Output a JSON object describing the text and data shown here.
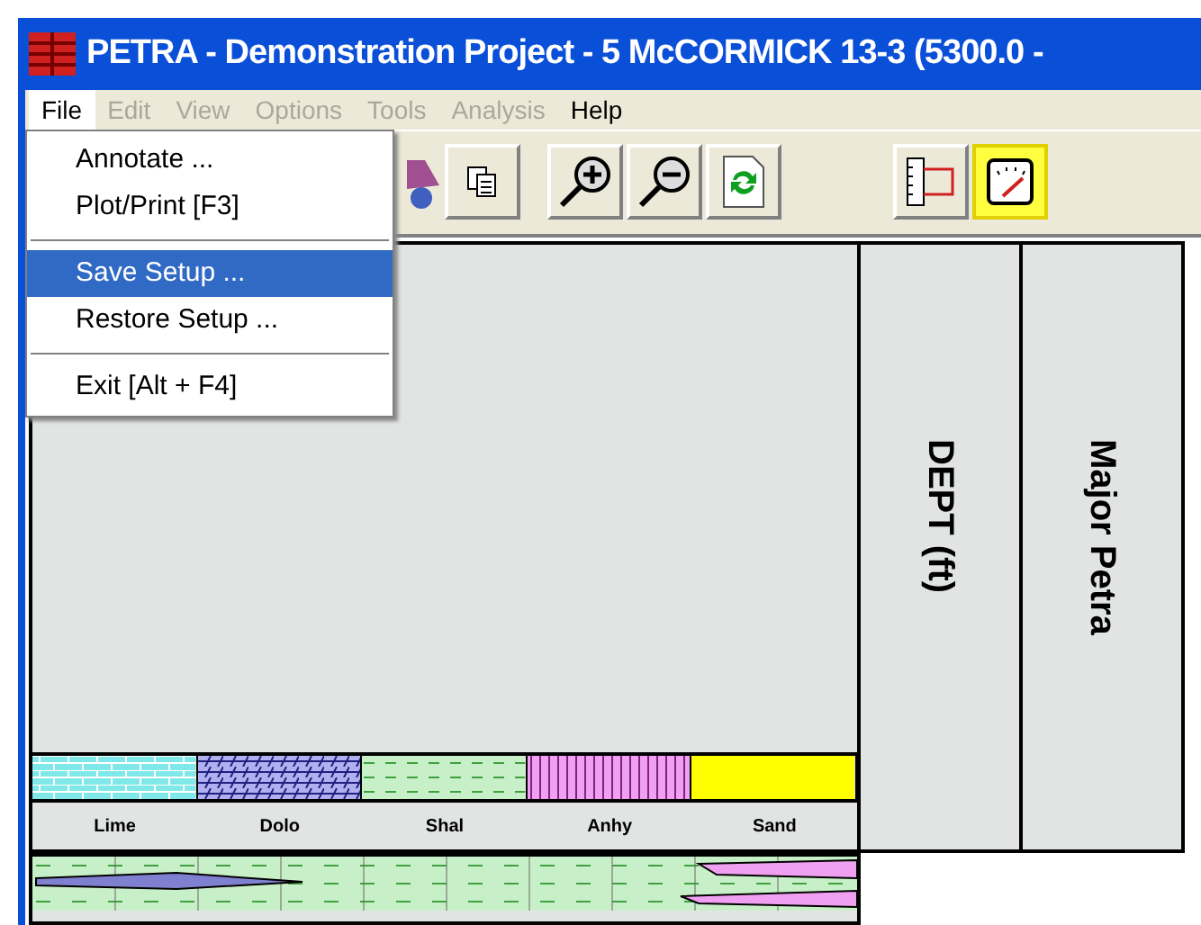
{
  "window": {
    "title": "PETRA - Demonstration Project - 5 McCORMICK 13-3 (5300.0 -"
  },
  "menu_bar": [
    {
      "label": "File",
      "disabled": false,
      "selected": true
    },
    {
      "label": "Edit",
      "disabled": true,
      "selected": false
    },
    {
      "label": "View",
      "disabled": true,
      "selected": false
    },
    {
      "label": "Options",
      "disabled": true,
      "selected": false
    },
    {
      "label": "Tools",
      "disabled": true,
      "selected": false
    },
    {
      "label": "Analysis",
      "disabled": true,
      "selected": false
    },
    {
      "label": "Help",
      "disabled": false,
      "selected": false
    }
  ],
  "file_menu": [
    {
      "kind": "item",
      "label": "Annotate ...",
      "selected": false
    },
    {
      "kind": "item",
      "label": "Plot/Print [F3]",
      "selected": false
    },
    {
      "kind": "separator"
    },
    {
      "kind": "item",
      "label": "Save Setup ...",
      "selected": true
    },
    {
      "kind": "item",
      "label": "Restore Setup ...",
      "selected": false
    },
    {
      "kind": "separator"
    },
    {
      "kind": "item",
      "label": "Exit [Alt + F4]",
      "selected": false
    }
  ],
  "legend": [
    {
      "label": "Lime",
      "kind": "brick",
      "color": "#80e8e8"
    },
    {
      "label": "Dolo",
      "kind": "slant",
      "color": "#b0b0f0"
    },
    {
      "label": "Shal",
      "kind": "dash",
      "color": "#c8f0c8"
    },
    {
      "label": "Anhy",
      "kind": "vline",
      "color": "#f0a0f0"
    },
    {
      "label": "Sand",
      "kind": "solid",
      "color": "#ffff00"
    }
  ],
  "tracks": [
    {
      "title": "DEPT (ft)"
    },
    {
      "title": "Major Petra"
    }
  ]
}
